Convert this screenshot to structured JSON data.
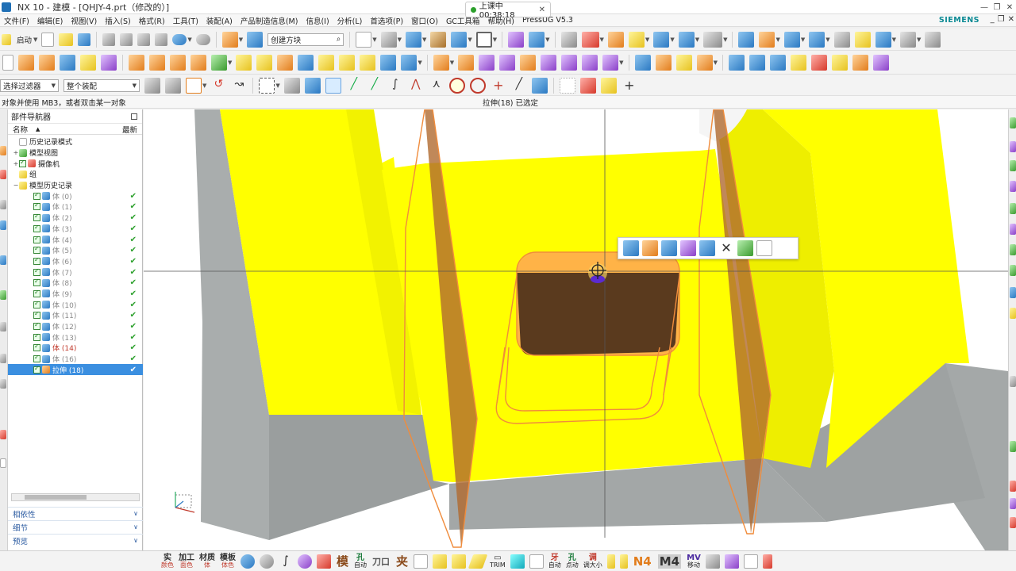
{
  "window": {
    "title": "NX 10 - 建模 - [QHJY-4.prt（修改的）]",
    "brand": "SIEMENS"
  },
  "timer": {
    "label": "上课中 00:38:18",
    "close": "✕"
  },
  "menu": [
    "文件(F)",
    "编辑(E)",
    "视图(V)",
    "插入(S)",
    "格式(R)",
    "工具(T)",
    "装配(A)",
    "产品制造信息(M)",
    "信息(I)",
    "分析(L)",
    "首选项(P)",
    "窗口(O)",
    "GC工具箱",
    "帮助(H)",
    "PressUG V5.3"
  ],
  "toolbar1": {
    "start_label": "启动",
    "search_placeholder": "创建方块"
  },
  "toolbar3": {
    "filter_combo": "选择过滤器",
    "assembly_combo": "整个装配"
  },
  "status": {
    "prompt": "对象并使用 MB3，或者双击某一对象",
    "selection": "拉伸(18) 已选定"
  },
  "navigator": {
    "title": "部件导航器",
    "col_name": "名称",
    "col_latest": "最新",
    "tree": [
      {
        "label": "历史记录模式",
        "level": 0,
        "icon": "clock-icon",
        "style": "normal",
        "ok": false
      },
      {
        "label": "模型视图",
        "level": 0,
        "expand": "+",
        "icon": "model-views-icon",
        "style": "normal",
        "ok": false
      },
      {
        "label": "摄像机",
        "level": 0,
        "expand": "+",
        "icon": "camera-icon",
        "style": "normal",
        "ok": false,
        "check": true
      },
      {
        "label": "组",
        "level": 0,
        "icon": "folder-icon",
        "style": "normal",
        "ok": false
      },
      {
        "label": "模型历史记录",
        "level": 0,
        "expand": "−",
        "icon": "folder-icon",
        "style": "normal",
        "ok": false
      },
      {
        "label": "体 (0)",
        "level": 1,
        "icon": "body-icon",
        "style": "dim",
        "ok": true,
        "check": true
      },
      {
        "label": "体 (1)",
        "level": 1,
        "icon": "body-icon",
        "style": "dim",
        "ok": true,
        "check": true
      },
      {
        "label": "体 (2)",
        "level": 1,
        "icon": "body-icon",
        "style": "dim",
        "ok": true,
        "check": true
      },
      {
        "label": "体 (3)",
        "level": 1,
        "icon": "body-icon",
        "style": "dim",
        "ok": true,
        "check": true
      },
      {
        "label": "体 (4)",
        "level": 1,
        "icon": "body-icon",
        "style": "dim",
        "ok": true,
        "check": true
      },
      {
        "label": "体 (5)",
        "level": 1,
        "icon": "body-icon",
        "style": "dim",
        "ok": true,
        "check": true
      },
      {
        "label": "体 (6)",
        "level": 1,
        "icon": "body-icon",
        "style": "dim",
        "ok": true,
        "check": true
      },
      {
        "label": "体 (7)",
        "level": 1,
        "icon": "body-icon",
        "style": "dim",
        "ok": true,
        "check": true
      },
      {
        "label": "体 (8)",
        "level": 1,
        "icon": "body-icon",
        "style": "dim",
        "ok": true,
        "check": true
      },
      {
        "label": "体 (9)",
        "level": 1,
        "icon": "body-icon",
        "style": "dim",
        "ok": true,
        "check": true
      },
      {
        "label": "体 (10)",
        "level": 1,
        "icon": "body-icon",
        "style": "dim",
        "ok": true,
        "check": true
      },
      {
        "label": "体 (11)",
        "level": 1,
        "icon": "body-icon",
        "style": "dim",
        "ok": true,
        "check": true
      },
      {
        "label": "体 (12)",
        "level": 1,
        "icon": "body-icon",
        "style": "dim",
        "ok": true,
        "check": true
      },
      {
        "label": "体 (13)",
        "level": 1,
        "icon": "body-icon",
        "style": "dim",
        "ok": true,
        "check": true
      },
      {
        "label": "体 (14)",
        "level": 1,
        "icon": "body-icon",
        "style": "red",
        "ok": true,
        "check": true
      },
      {
        "label": "体 (16)",
        "level": 1,
        "icon": "body-icon",
        "style": "dim",
        "ok": true,
        "check": true
      },
      {
        "label": "拉伸 (18)",
        "level": 1,
        "icon": "extrude-icon",
        "style": "selected",
        "ok": true,
        "check": true
      }
    ],
    "panels": [
      "相依性",
      "细节",
      "预览"
    ]
  },
  "bottombar": {
    "items": [
      {
        "big": "实",
        "small": "颜色"
      },
      {
        "big": "加工",
        "small": "面色"
      },
      {
        "big": "材质",
        "small": "体"
      },
      {
        "big": "模板",
        "small": "体色"
      }
    ],
    "labels": [
      "模",
      "孔",
      "刀口",
      "夹",
      "TRIM",
      "牙",
      "孔",
      "调",
      "N4",
      "M4",
      "MV"
    ],
    "label_subs": [
      "",
      "自动",
      "",
      "",
      "",
      "自动",
      "点动",
      "调大小",
      "",
      "",
      "移动"
    ]
  },
  "colors": {
    "part_yellow": "#ffff00",
    "part_gray": "#a8acac",
    "highlight_orange": "#f08c3c",
    "selected_blue": "#3b8fe0"
  }
}
